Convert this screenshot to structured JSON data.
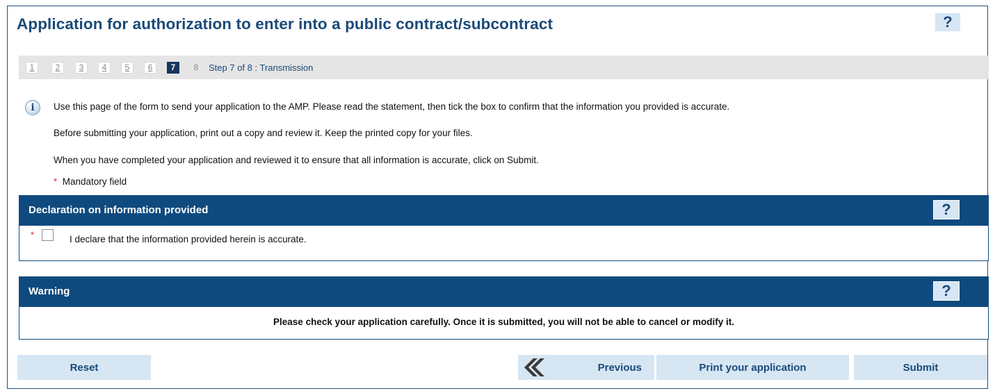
{
  "header": {
    "title": "Application for authorization to enter into a public contract/subcontract",
    "help_label": "?"
  },
  "stepper": {
    "steps": [
      "1",
      "2",
      "3",
      "4",
      "5",
      "6",
      "7",
      "8"
    ],
    "current_step": 7,
    "label": "Step 7 of 8 : Transmission"
  },
  "instructions": {
    "line1": "Use this page of the form to send your application to the AMP. Please read the statement, then tick the box to confirm that the information you provided is accurate.",
    "line2": "Before submitting your application, print out a copy and review it. Keep the printed copy for your files.",
    "line3": "When you have completed your application and reviewed it to ensure that all information is accurate, click on Submit.",
    "mandatory_star": "*",
    "mandatory_note": "Mandatory field",
    "info_icon_glyph": "i"
  },
  "declaration": {
    "title": "Declaration on information provided",
    "help_label": "?",
    "required_star": "*",
    "checkbox_label": "I declare that the information provided herein is accurate.",
    "checked": false
  },
  "warning": {
    "title": "Warning",
    "help_label": "?",
    "text": "Please check your application carefully. Once it is submitted, you will not be able to cancel or modify it."
  },
  "buttons": {
    "reset": "Reset",
    "previous": "Previous",
    "print": "Print your application",
    "submit": "Submit"
  },
  "colors": {
    "brand_dark_blue": "#0f4a7e",
    "title_blue": "#1a4a78",
    "button_light_blue": "#d6e6f3",
    "required_red": "#e0393e",
    "stepbar_gray": "#e5e5e5"
  },
  "icons": {
    "info": "info-icon",
    "help": "help-icon",
    "previous": "double-chevron-left-icon"
  }
}
